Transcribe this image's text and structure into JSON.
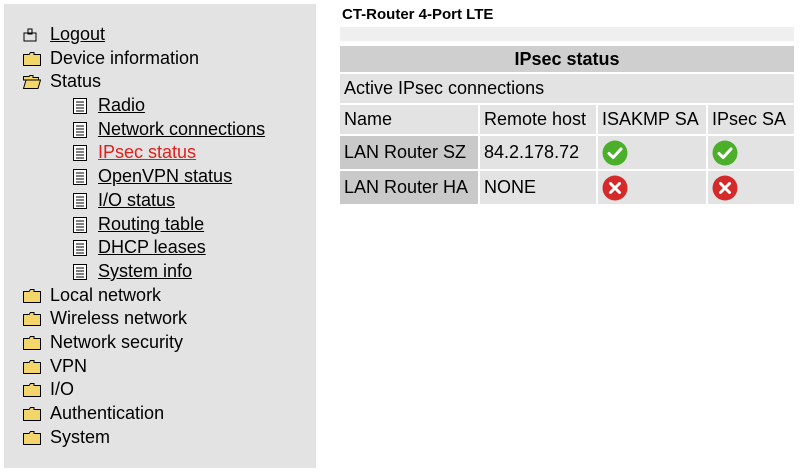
{
  "sidebar": {
    "logout": "Logout",
    "items": [
      {
        "label": "Device information"
      },
      {
        "label": "Status"
      },
      {
        "label": "Local network"
      },
      {
        "label": "Wireless network"
      },
      {
        "label": "Network security"
      },
      {
        "label": "VPN"
      },
      {
        "label": "I/O"
      },
      {
        "label": "Authentication"
      },
      {
        "label": "System"
      }
    ],
    "status_children": [
      {
        "label": "Radio"
      },
      {
        "label": "Network connections"
      },
      {
        "label": "IPsec status"
      },
      {
        "label": "OpenVPN status"
      },
      {
        "label": "I/O status"
      },
      {
        "label": "Routing table"
      },
      {
        "label": "DHCP leases"
      },
      {
        "label": "System info"
      }
    ]
  },
  "page": {
    "title": "CT-Router 4-Port LTE"
  },
  "ipsec": {
    "header": "IPsec status",
    "subheader": "Active IPsec connections",
    "columns": [
      "Name",
      "Remote host",
      "ISAKMP SA",
      "IPsec SA"
    ],
    "rows": [
      {
        "name": "LAN Router SZ",
        "remote_host": "84.2.178.72",
        "isakmp": "ok-icon",
        "ipsec": "ok-icon"
      },
      {
        "name": "LAN Router HA",
        "remote_host": "NONE",
        "isakmp": "error-icon",
        "ipsec": "error-icon"
      }
    ]
  },
  "colors": {
    "active_link": "#e0201b",
    "ok": "#4caf2a",
    "error": "#d42a2a"
  }
}
